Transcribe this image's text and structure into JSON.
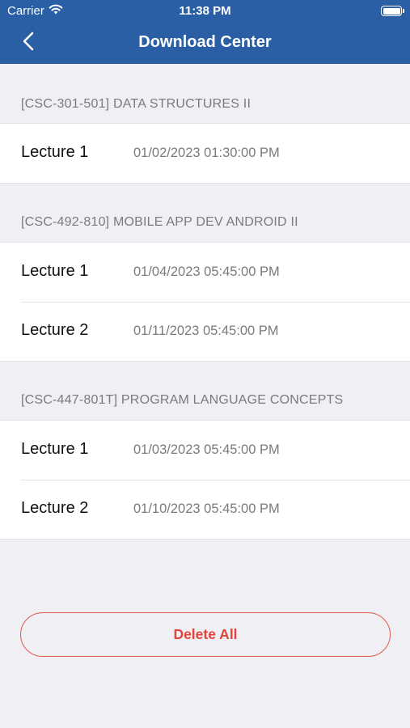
{
  "status_bar": {
    "carrier": "Carrier",
    "time": "11:38 PM"
  },
  "nav": {
    "title": "Download Center"
  },
  "sections": [
    {
      "header": "[CSC-301-501] DATA STRUCTURES II",
      "items": [
        {
          "title": "Lecture 1",
          "date": "01/02/2023 01:30:00 PM"
        }
      ]
    },
    {
      "header": "[CSC-492-810] MOBILE APP DEV ANDROID II",
      "items": [
        {
          "title": "Lecture 1",
          "date": "01/04/2023 05:45:00 PM"
        },
        {
          "title": "Lecture 2",
          "date": "01/11/2023 05:45:00 PM"
        }
      ]
    },
    {
      "header": "[CSC-447-801T] PROGRAM LANGUAGE CONCEPTS",
      "items": [
        {
          "title": "Lecture 1",
          "date": "01/03/2023 05:45:00 PM"
        },
        {
          "title": "Lecture 2",
          "date": "01/10/2023 05:45:00 PM"
        }
      ]
    }
  ],
  "actions": {
    "delete_all": "Delete All"
  },
  "colors": {
    "nav_background": "#2a5fa6",
    "destructive": "#e0453b",
    "page_background": "#efeff4"
  }
}
